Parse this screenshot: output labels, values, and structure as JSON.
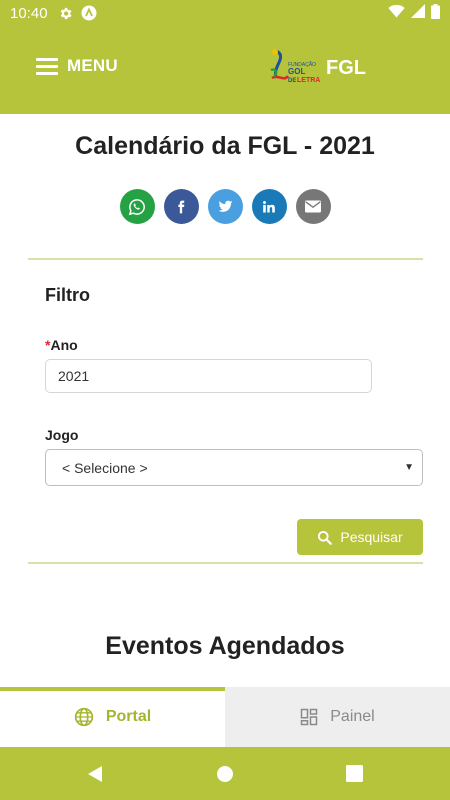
{
  "status_bar": {
    "time": "10:40"
  },
  "app_bar": {
    "menu_label": "MENU",
    "logo_small_text": "FUNDAÇÃO",
    "logo_gol": "GOL",
    "logo_de": "DE",
    "logo_letra": "LETRA",
    "logo_text": "FGL"
  },
  "page": {
    "title": "Calendário da FGL - 2021",
    "share_icons": [
      "whatsapp-icon",
      "facebook-icon",
      "twitter-icon",
      "linkedin-icon",
      "email-icon"
    ]
  },
  "filter": {
    "title": "Filtro",
    "year": {
      "required_mark": "*",
      "label": "Ano",
      "value": "2021"
    },
    "game": {
      "label": "Jogo",
      "value": "< Selecione >"
    },
    "search_label": "Pesquisar"
  },
  "events": {
    "title": "Eventos Agendados"
  },
  "tabs": [
    {
      "label": "Portal",
      "icon": "globe-icon",
      "active": true
    },
    {
      "label": "Painel",
      "icon": "dashboard-icon",
      "active": false
    }
  ],
  "colors": {
    "brand": "#b5c43a",
    "whatsapp": "#25a244",
    "facebook": "#3b5998",
    "twitter": "#4a9fe0",
    "linkedin": "#1a7ab8",
    "email": "#777777"
  }
}
